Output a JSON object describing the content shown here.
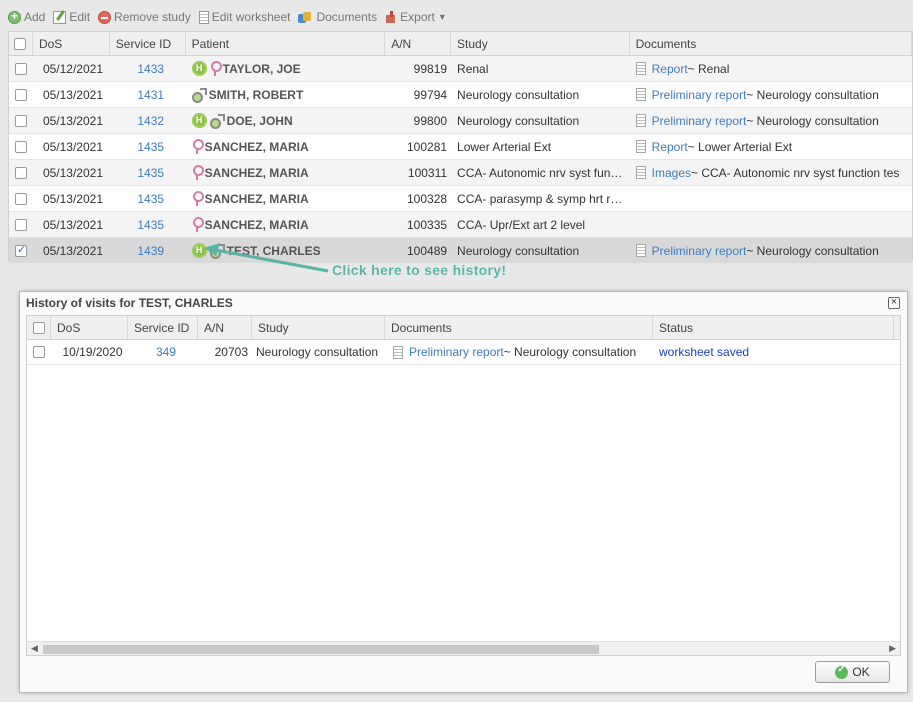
{
  "toolbar": {
    "add": "Add",
    "edit": "Edit",
    "remove": "Remove study",
    "edit_worksheet": "Edit worksheet",
    "documents": "Documents",
    "export": "Export"
  },
  "grid": {
    "headers": {
      "dos": "DoS",
      "service_id": "Service ID",
      "patient": "Patient",
      "an": "A/N",
      "study": "Study",
      "documents": "Documents"
    },
    "rows": [
      {
        "dos": "05/12/2021",
        "service_id": "1433",
        "patient": "TAYLOR, JOE",
        "an": "99819",
        "study": "Renal",
        "doc_link": "Report",
        "doc_rest": " ~ Renal"
      },
      {
        "dos": "05/13/2021",
        "service_id": "1431",
        "patient": "SMITH, ROBERT",
        "an": "99794",
        "study": "Neurology consultation",
        "doc_link": "Preliminary report",
        "doc_rest": " ~ Neurology consultation"
      },
      {
        "dos": "05/13/2021",
        "service_id": "1432",
        "patient": "DOE, JOHN",
        "an": "99800",
        "study": "Neurology consultation",
        "doc_link": "Preliminary report",
        "doc_rest": " ~ Neurology consultation"
      },
      {
        "dos": "05/13/2021",
        "service_id": "1435",
        "patient": "SANCHEZ, MARIA",
        "an": "100281",
        "study": "Lower Arterial Ext",
        "doc_link": "Report",
        "doc_rest": " ~ Lower Arterial Ext"
      },
      {
        "dos": "05/13/2021",
        "service_id": "1435",
        "patient": "SANCHEZ, MARIA",
        "an": "100311",
        "study": "CCA- Autonomic nrv syst fun…",
        "doc_link": "Images",
        "doc_rest": " ~ CCA- Autonomic nrv syst function tes"
      },
      {
        "dos": "05/13/2021",
        "service_id": "1435",
        "patient": "SANCHEZ, MARIA",
        "an": "100328",
        "study": "CCA- parasymp & symp hrt r…",
        "doc_link": "",
        "doc_rest": ""
      },
      {
        "dos": "05/13/2021",
        "service_id": "1435",
        "patient": "SANCHEZ, MARIA",
        "an": "100335",
        "study": "CCA- Upr/Ext art 2 level",
        "doc_link": "",
        "doc_rest": ""
      },
      {
        "dos": "05/13/2021",
        "service_id": "1439",
        "patient": "TEST, CHARLES",
        "an": "100489",
        "study": "Neurology consultation",
        "doc_link": "Preliminary report",
        "doc_rest": " ~ Neurology consultation"
      }
    ]
  },
  "callout": "Click here to see history!",
  "history": {
    "title": "History of visits for TEST, CHARLES",
    "headers": {
      "dos": "DoS",
      "service_id": "Service ID",
      "an": "A/N",
      "study": "Study",
      "documents": "Documents",
      "status": "Status"
    },
    "row": {
      "dos": "10/19/2020",
      "service_id": "349",
      "an": "20703",
      "study": "Neurology consultation",
      "doc_link": "Preliminary report",
      "doc_rest": " ~ Neurology consultation",
      "status": "worksheet saved"
    },
    "ok": "OK",
    "close": "×"
  },
  "colors": {
    "link": "#3f7cbf",
    "status": "#1a3fc0",
    "callout": "#5ab3a3",
    "selected_row": "#d9d9d9"
  }
}
